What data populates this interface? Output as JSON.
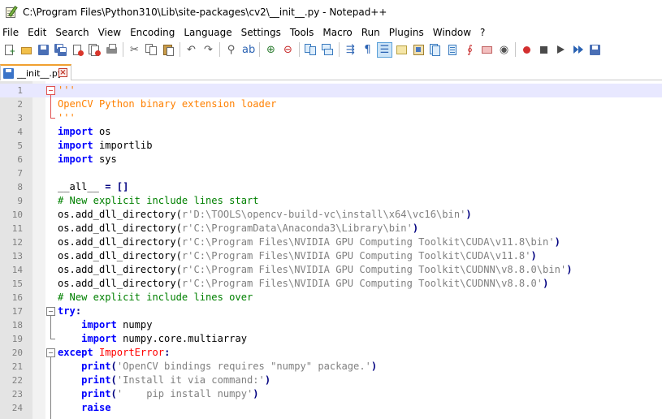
{
  "window": {
    "title": "C:\\Program Files\\Python310\\Lib\\site-packages\\cv2\\__init__.py - Notepad++"
  },
  "menu": [
    "File",
    "Edit",
    "Search",
    "View",
    "Encoding",
    "Language",
    "Settings",
    "Tools",
    "Macro",
    "Run",
    "Plugins",
    "Window",
    "?"
  ],
  "tabs": [
    {
      "label": "__init__.py",
      "active": true
    }
  ],
  "colors": {
    "keyword": "#0000ff",
    "docstring": "#ff8000",
    "comment": "#008000",
    "string": "#808080",
    "current_line": "#e8e8ff",
    "tab_accent": "#f0a030"
  },
  "editor": {
    "line_numbers": [
      "1",
      "2",
      "3",
      "4",
      "5",
      "6",
      "7",
      "8",
      "9",
      "10",
      "11",
      "12",
      "13",
      "14",
      "15",
      "16",
      "17",
      "18",
      "19",
      "20",
      "21",
      "22",
      "23",
      "24"
    ],
    "lines": [
      [
        {
          "t": "'''",
          "c": "c-doc"
        }
      ],
      [
        {
          "t": "OpenCV Python binary extension loader",
          "c": "c-doc"
        }
      ],
      [
        {
          "t": "'''",
          "c": "c-doc"
        }
      ],
      [
        {
          "t": "import",
          "c": "c-kw"
        },
        {
          "t": " os",
          "c": "c-id"
        }
      ],
      [
        {
          "t": "import",
          "c": "c-kw"
        },
        {
          "t": " importlib",
          "c": "c-id"
        }
      ],
      [
        {
          "t": "import",
          "c": "c-kw"
        },
        {
          "t": " sys",
          "c": "c-id"
        }
      ],
      [],
      [
        {
          "t": "__all__ ",
          "c": "c-id"
        },
        {
          "t": "=",
          "c": "c-op"
        },
        {
          "t": " []",
          "c": "c-op"
        }
      ],
      [
        {
          "t": "# New explicit include lines start",
          "c": "c-cmt"
        }
      ],
      [
        {
          "t": "os.add_dll_directory(",
          "c": "c-id"
        },
        {
          "t": "r'D:\\TOOLS\\opencv-build-vc\\install\\x64\\vc16\\bin'",
          "c": "c-str"
        },
        {
          "t": ")",
          "c": "c-op"
        }
      ],
      [
        {
          "t": "os.add_dll_directory(",
          "c": "c-id"
        },
        {
          "t": "r'C:\\ProgramData\\Anaconda3\\Library\\bin'",
          "c": "c-str"
        },
        {
          "t": ")",
          "c": "c-op"
        }
      ],
      [
        {
          "t": "os.add_dll_directory(",
          "c": "c-id"
        },
        {
          "t": "r'C:\\Program Files\\NVIDIA GPU Computing Toolkit\\CUDA\\v11.8\\bin'",
          "c": "c-str"
        },
        {
          "t": ")",
          "c": "c-op"
        }
      ],
      [
        {
          "t": "os.add_dll_directory(",
          "c": "c-id"
        },
        {
          "t": "r'C:\\Program Files\\NVIDIA GPU Computing Toolkit\\CUDA\\v11.8'",
          "c": "c-str"
        },
        {
          "t": ")",
          "c": "c-op"
        }
      ],
      [
        {
          "t": "os.add_dll_directory(",
          "c": "c-id"
        },
        {
          "t": "r'C:\\Program Files\\NVIDIA GPU Computing Toolkit\\CUDNN\\v8.8.0\\bin'",
          "c": "c-str"
        },
        {
          "t": ")",
          "c": "c-op"
        }
      ],
      [
        {
          "t": "os.add_dll_directory(",
          "c": "c-id"
        },
        {
          "t": "r'C:\\Program Files\\NVIDIA GPU Computing Toolkit\\CUDNN\\v8.8.0'",
          "c": "c-str"
        },
        {
          "t": ")",
          "c": "c-op"
        }
      ],
      [
        {
          "t": "# New explicit include lines over",
          "c": "c-cmt"
        }
      ],
      [
        {
          "t": "try",
          "c": "c-kw"
        },
        {
          "t": ":",
          "c": "c-op"
        }
      ],
      [
        {
          "t": "    ",
          "c": "c-id"
        },
        {
          "t": "import",
          "c": "c-kw"
        },
        {
          "t": " numpy",
          "c": "c-id"
        }
      ],
      [
        {
          "t": "    ",
          "c": "c-id"
        },
        {
          "t": "import",
          "c": "c-kw"
        },
        {
          "t": " numpy.core.multiarray",
          "c": "c-id"
        }
      ],
      [
        {
          "t": "except",
          "c": "c-kw"
        },
        {
          "t": " ImportError",
          "c": "c-cls"
        },
        {
          "t": ":",
          "c": "c-op"
        }
      ],
      [
        {
          "t": "    ",
          "c": "c-id"
        },
        {
          "t": "print",
          "c": "c-kw"
        },
        {
          "t": "(",
          "c": "c-op"
        },
        {
          "t": "'OpenCV bindings requires \"numpy\" package.'",
          "c": "c-str"
        },
        {
          "t": ")",
          "c": "c-op"
        }
      ],
      [
        {
          "t": "    ",
          "c": "c-id"
        },
        {
          "t": "print",
          "c": "c-kw"
        },
        {
          "t": "(",
          "c": "c-op"
        },
        {
          "t": "'Install it via command:'",
          "c": "c-str"
        },
        {
          "t": ")",
          "c": "c-op"
        }
      ],
      [
        {
          "t": "    ",
          "c": "c-id"
        },
        {
          "t": "print",
          "c": "c-kw"
        },
        {
          "t": "(",
          "c": "c-op"
        },
        {
          "t": "'    pip install numpy'",
          "c": "c-str"
        },
        {
          "t": ")",
          "c": "c-op"
        }
      ],
      [
        {
          "t": "    ",
          "c": "c-id"
        },
        {
          "t": "raise",
          "c": "c-kw"
        }
      ]
    ]
  }
}
